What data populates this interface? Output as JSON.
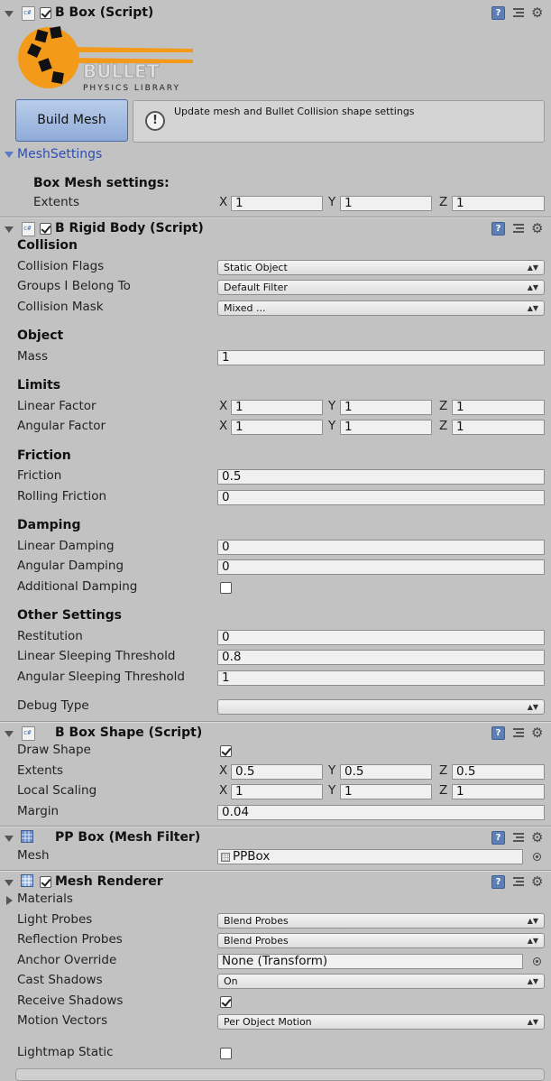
{
  "bbox_script": {
    "title": "B Box (Script)",
    "logo": {
      "top_text": "BULLET",
      "bottom_text": "PHYSICS LIBRARY"
    },
    "build_mesh_label": "Build Mesh",
    "info_text": "Update mesh and Bullet Collision shape settings",
    "mesh_settings_label": "MeshSettings",
    "box_mesh_settings_label": "Box Mesh settings:",
    "extents_label": "Extents",
    "extents": {
      "x": "1",
      "y": "1",
      "z": "1"
    }
  },
  "axis_labels": {
    "x": "X",
    "y": "Y",
    "z": "Z"
  },
  "rigid_body": {
    "title": "B Rigid Body (Script)",
    "collision_heading": "Collision",
    "collision_flags_label": "Collision Flags",
    "collision_flags_value": "Static Object",
    "groups_label": "Groups I Belong To",
    "groups_value": "Default Filter",
    "collision_mask_label": "Collision Mask",
    "collision_mask_value": "Mixed ...",
    "object_heading": "Object",
    "mass_label": "Mass",
    "mass_value": "1",
    "limits_heading": "Limits",
    "linear_factor_label": "Linear Factor",
    "linear_factor": {
      "x": "1",
      "y": "1",
      "z": "1"
    },
    "angular_factor_label": "Angular Factor",
    "angular_factor": {
      "x": "1",
      "y": "1",
      "z": "1"
    },
    "friction_heading": "Friction",
    "friction_label": "Friction",
    "friction_value": "0.5",
    "rolling_friction_label": "Rolling Friction",
    "rolling_friction_value": "0",
    "damping_heading": "Damping",
    "linear_damping_label": "Linear Damping",
    "linear_damping_value": "0",
    "angular_damping_label": "Angular Damping",
    "angular_damping_value": "0",
    "additional_damping_label": "Additional Damping",
    "additional_damping_checked": false,
    "other_heading": "Other Settings",
    "restitution_label": "Restitution",
    "restitution_value": "0",
    "linear_sleep_label": "Linear Sleeping Threshold",
    "linear_sleep_value": "0.8",
    "angular_sleep_label": "Angular Sleeping Threshold",
    "angular_sleep_value": "1",
    "debug_type_label": "Debug Type",
    "debug_type_value": ""
  },
  "box_shape": {
    "title": "B Box Shape (Script)",
    "draw_shape_label": "Draw Shape",
    "draw_shape_checked": true,
    "extents_label": "Extents",
    "extents": {
      "x": "0.5",
      "y": "0.5",
      "z": "0.5"
    },
    "local_scaling_label": "Local Scaling",
    "local_scaling": {
      "x": "1",
      "y": "1",
      "z": "1"
    },
    "margin_label": "Margin",
    "margin_value": "0.04"
  },
  "mesh_filter": {
    "title": "PP Box (Mesh Filter)",
    "mesh_label": "Mesh",
    "mesh_value": "PPBox"
  },
  "mesh_renderer": {
    "title": "Mesh Renderer",
    "materials_label": "Materials",
    "light_probes_label": "Light Probes",
    "light_probes_value": "Blend Probes",
    "reflection_probes_label": "Reflection Probes",
    "reflection_probes_value": "Blend Probes",
    "anchor_override_label": "Anchor Override",
    "anchor_override_value": "None (Transform)",
    "cast_shadows_label": "Cast Shadows",
    "cast_shadows_value": "On",
    "receive_shadows_label": "Receive Shadows",
    "receive_shadows_checked": true,
    "motion_vectors_label": "Motion Vectors",
    "motion_vectors_value": "Per Object Motion",
    "lightmap_static_label": "Lightmap Static",
    "lightmap_static_checked": false
  },
  "colors": {
    "panel_bg": "#c2c2c2",
    "accent_link": "#2b4fb4",
    "logo_orange": "#f49a1a"
  }
}
